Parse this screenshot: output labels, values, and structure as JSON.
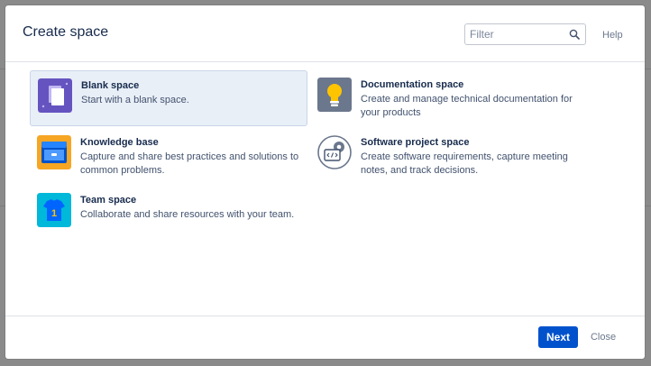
{
  "dialog": {
    "title": "Create space",
    "filter_placeholder": "Filter",
    "help_label": "Help",
    "next_label": "Next",
    "close_label": "Close"
  },
  "spaces": [
    {
      "name": "Blank space",
      "description": "Start with a blank space.",
      "icon": "blank-space-icon",
      "selected": true
    },
    {
      "name": "Documentation space",
      "description": "Create and manage technical documentation for your products",
      "icon": "lightbulb-icon",
      "selected": false
    },
    {
      "name": "Knowledge base",
      "description": "Capture and share best practices and solutions to common problems.",
      "icon": "knowledge-base-icon",
      "selected": false
    },
    {
      "name": "Software project space",
      "description": "Create software requirements, capture meeting notes, and track decisions.",
      "icon": "code-gear-icon",
      "selected": false
    },
    {
      "name": "Team space",
      "description": "Collaborate and share resources with your team.",
      "icon": "team-shirt-icon",
      "selected": false
    }
  ],
  "colors": {
    "primary_button": "#0052cc",
    "selected_tile": "#e9eff7",
    "title_text": "#172b4d"
  }
}
